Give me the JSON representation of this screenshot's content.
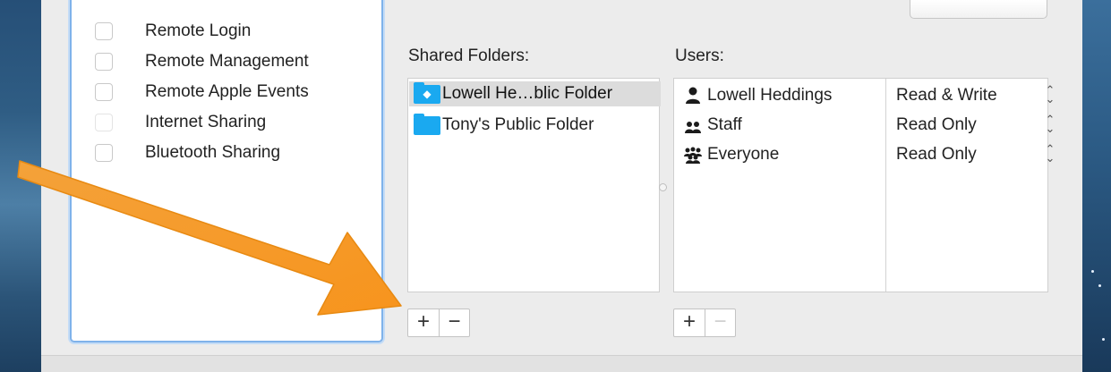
{
  "services": {
    "items": [
      {
        "label": "Remote Login",
        "checked": false
      },
      {
        "label": "Remote Management",
        "checked": false
      },
      {
        "label": "Remote Apple Events",
        "checked": false
      },
      {
        "label": "Internet Sharing",
        "checked": false,
        "disabled": true
      },
      {
        "label": "Bluetooth Sharing",
        "checked": false
      }
    ]
  },
  "shared_folders": {
    "heading": "Shared Folders:",
    "items": [
      {
        "label": "Lowell He…blic Folder",
        "selected": true,
        "icon": "public-folder-icon"
      },
      {
        "label": "Tony's Public Folder",
        "selected": false,
        "icon": "folder-icon"
      }
    ],
    "add_label": "+",
    "remove_label": "−"
  },
  "users": {
    "heading": "Users:",
    "items": [
      {
        "name": "Lowell Heddings",
        "permission": "Read & Write",
        "icon": "user-icon"
      },
      {
        "name": "Staff",
        "permission": "Read Only",
        "icon": "group-icon"
      },
      {
        "name": "Everyone",
        "permission": "Read Only",
        "icon": "everyone-icon"
      }
    ],
    "stepper_glyph": "⌃⌄",
    "add_label": "+",
    "remove_label": "−"
  },
  "colors": {
    "selection_border": "#7fb2ea",
    "folder_blue": "#1aa9f0",
    "arrow_orange": "#f7941d"
  }
}
